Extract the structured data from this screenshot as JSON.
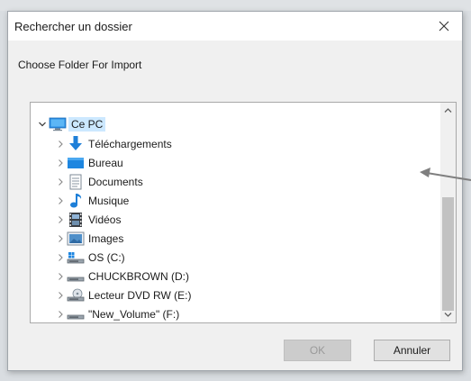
{
  "dialog": {
    "title": "Rechercher un dossier",
    "prompt": "Choose Folder For Import",
    "ok_label": "OK",
    "cancel_label": "Annuler"
  },
  "tree": {
    "root": {
      "label": "Ce PC",
      "icon": "computer-icon",
      "expanded": true,
      "selected": true
    },
    "items": [
      {
        "label": "Téléchargements",
        "icon": "download-arrow-icon"
      },
      {
        "label": "Bureau",
        "icon": "desktop-icon"
      },
      {
        "label": "Documents",
        "icon": "documents-icon"
      },
      {
        "label": "Musique",
        "icon": "music-note-icon"
      },
      {
        "label": "Vidéos",
        "icon": "video-icon"
      },
      {
        "label": "Images",
        "icon": "images-icon"
      },
      {
        "label": "OS (C:)",
        "icon": "windows-drive-icon"
      },
      {
        "label": "CHUCKBROWN (D:)",
        "icon": "drive-icon"
      },
      {
        "label": "Lecteur DVD RW (E:)",
        "icon": "dvd-drive-icon"
      },
      {
        "label": "\"New_Volume\" (F:)",
        "icon": "drive-icon"
      }
    ]
  },
  "colors": {
    "selection": "#cce8ff",
    "window_bg": "#f0f0f0",
    "accent_blue": "#1e7fd8"
  }
}
